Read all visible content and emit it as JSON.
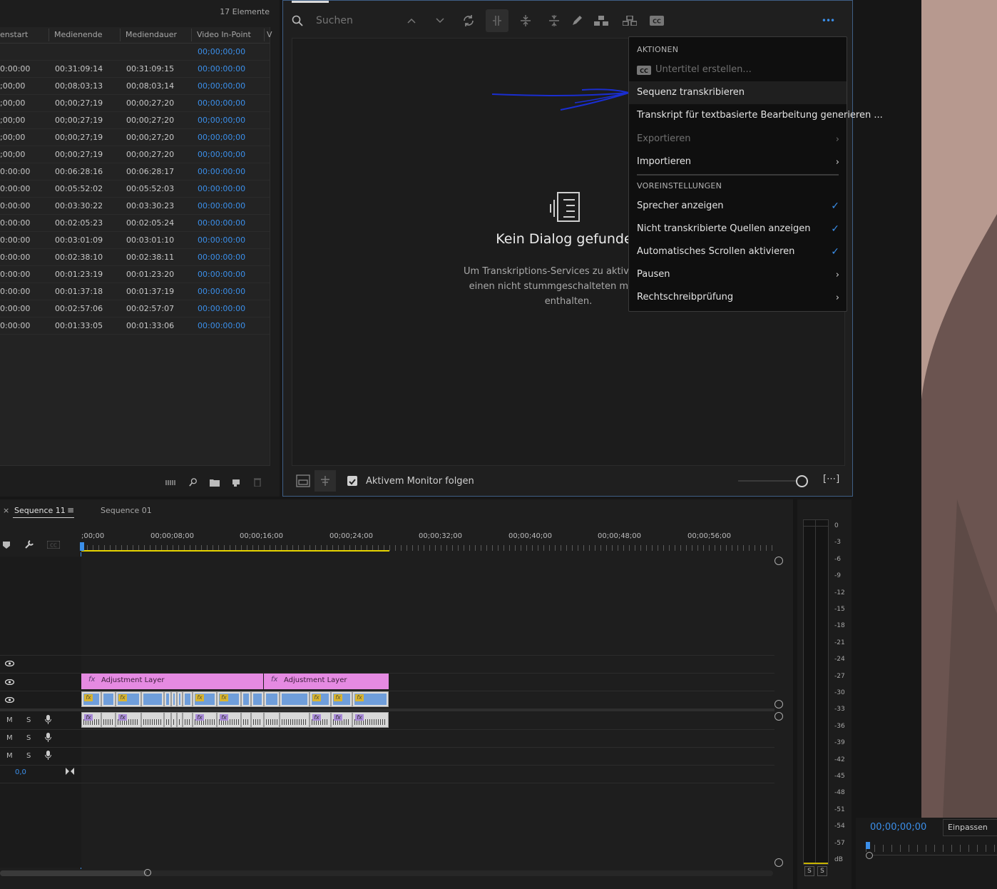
{
  "project": {
    "item_count": "17 Elemente",
    "columns": [
      "enstart",
      "Medienende",
      "Mediendauer",
      "Video In-Point",
      "V"
    ],
    "rows": [
      [
        "",
        "",
        "",
        "00;00;00;00"
      ],
      [
        "0:00:00",
        "00:31:09:14",
        "00:31:09:15",
        "00:00:00:00"
      ],
      [
        ";00;00",
        "00;08;03;13",
        "00;08;03;14",
        "00;00;00;00"
      ],
      [
        ";00;00",
        "00;00;27;19",
        "00;00;27;20",
        "00;00;00;00"
      ],
      [
        ";00;00",
        "00;00;27;19",
        "00;00;27;20",
        "00;00;00;00"
      ],
      [
        ";00;00",
        "00;00;27;19",
        "00;00;27;20",
        "00;00;00;00"
      ],
      [
        ";00;00",
        "00;00;27;19",
        "00;00;27;20",
        "00;00;00;00"
      ],
      [
        "0:00:00",
        "00:06:28:16",
        "00:06:28:17",
        "00:00:00:00"
      ],
      [
        "0:00:00",
        "00:05:52:02",
        "00:05:52:03",
        "00:00:00:00"
      ],
      [
        "0:00:00",
        "00:03:30:22",
        "00:03:30:23",
        "00:00:00:00"
      ],
      [
        "0:00:00",
        "00:02:05:23",
        "00:02:05:24",
        "00:00:00:00"
      ],
      [
        "0:00:00",
        "00:03:01:09",
        "00:03:01:10",
        "00:00:00:00"
      ],
      [
        "0:00:00",
        "00:02:38:10",
        "00:02:38:11",
        "00:00:00:00"
      ],
      [
        "0:00:00",
        "00:01:23:19",
        "00:01:23:20",
        "00:00:00:00"
      ],
      [
        "0:00:00",
        "00:01:37:18",
        "00:01:37:19",
        "00:00:00:00"
      ],
      [
        "0:00:00",
        "00:02:57:06",
        "00:02:57:07",
        "00:00:00:00"
      ],
      [
        "0:00:00",
        "00:01:33:05",
        "00:01:33:06",
        "00:00:00:00"
      ]
    ]
  },
  "transcript": {
    "search_placeholder": "Suchen",
    "empty_title": "Kein Dialog gefunden",
    "empty_desc": "Um Transkriptions-Services zu aktivieren, mu einen nicht stummgeschalteten mündliche enthalten.",
    "follow_label": "Aktivem Monitor folgen",
    "more_label": "•••",
    "expand_label": "[⋯]"
  },
  "menu": {
    "section_actions": "AKTIONEN",
    "create_captions": "Untertitel erstellen...",
    "transcribe_sequence": "Sequenz transkribieren",
    "generate_transcript": "Transkript für textbasierte Bearbeitung generieren ...",
    "export": "Exportieren",
    "import": "Importieren",
    "section_presets": "VOREINSTELLUNGEN",
    "show_speakers": "Sprecher anzeigen",
    "show_untranscribed": "Nicht transkribierte Quellen anzeigen",
    "auto_scroll": "Automatisches Scrollen aktivieren",
    "pauses": "Pausen",
    "spellcheck": "Rechtschreibprüfung"
  },
  "timeline": {
    "close_glyph": "×",
    "tab_active": "Sequence 11",
    "tab_other": "Sequence 01",
    "ruler_labels": [
      ";00;00",
      "00;00;08;00",
      "00;00;16;00",
      "00;00;24;00",
      "00;00;32;00",
      "00;00;40;00",
      "00;00;48;00",
      "00;00;56;00"
    ],
    "adjustment_layer": "Adjustment Layer",
    "mute": "M",
    "solo": "S",
    "volume": "0,0",
    "fx": "fx"
  },
  "meters": {
    "db_labels": [
      "0",
      "-3",
      "-6",
      "-9",
      "-12",
      "-15",
      "-18",
      "-21",
      "-24",
      "-27",
      "-30",
      "-33",
      "-36",
      "-39",
      "-42",
      "-45",
      "-48",
      "-51",
      "-54",
      "-57",
      "dB"
    ],
    "solo_left": "S",
    "solo_right": "S"
  },
  "program": {
    "timecode": "00;00;00;00",
    "fit": "Einpassen"
  },
  "colors": {
    "accent_blue": "#3b8fea",
    "adjustment_pink": "#e58ae2",
    "video_blue": "#6f9edb"
  }
}
